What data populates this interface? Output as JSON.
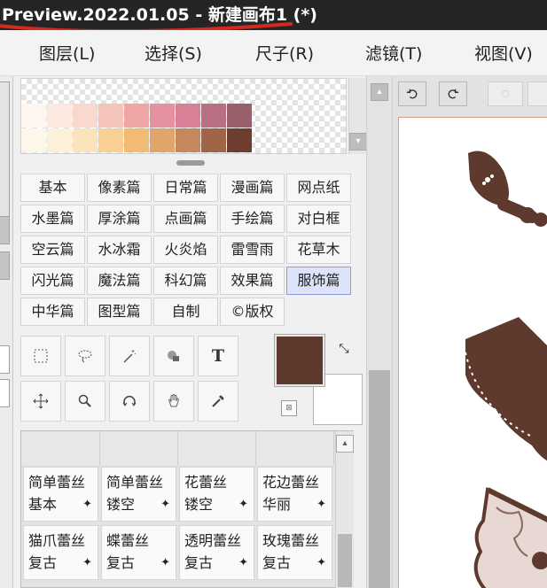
{
  "window": {
    "title": "Preview.2022.01.05 - 新建画布1 (*)"
  },
  "menu": [
    {
      "label": "图层(L)"
    },
    {
      "label": "选择(S)"
    },
    {
      "label": "尺子(R)"
    },
    {
      "label": "滤镜(T)"
    },
    {
      "label": "视图(V)"
    }
  ],
  "palette": {
    "row1": [
      "#fdf5ee",
      "#fbe9e0",
      "#f9d8cf",
      "#f4c3bb",
      "#eea7a4",
      "#e691a0",
      "#d88096",
      "#b97084",
      "#99606c"
    ],
    "row2": [
      "#fdf7e9",
      "#fcf0d8",
      "#fbe3bb",
      "#f8cf95",
      "#f1bb73",
      "#e1a46b",
      "#c5885c",
      "#a06447",
      "#6d3d2f"
    ]
  },
  "brush_categories": [
    [
      "基本",
      "像素篇",
      "日常篇",
      "漫画篇",
      "网点纸"
    ],
    [
      "水墨篇",
      "厚涂篇",
      "点画篇",
      "手绘篇",
      "对白框"
    ],
    [
      "空云篇",
      "水冰霜",
      "火炎焰",
      "雷雪雨",
      "花草木"
    ],
    [
      "闪光篇",
      "魔法篇",
      "科幻篇",
      "效果篇",
      "服饰篇"
    ],
    [
      "中华篇",
      "图型篇",
      "自制",
      "©版权"
    ]
  ],
  "selected_category": "服饰篇",
  "tools": {
    "text_tool_label": "T",
    "primary_color": "#5e3a2e",
    "secondary_color": "#ffffff"
  },
  "brushes": [
    {
      "line1": "简单蕾丝",
      "line2": "基本"
    },
    {
      "line1": "简单蕾丝",
      "line2": "镂空"
    },
    {
      "line1": "花蕾丝",
      "line2": "镂空"
    },
    {
      "line1": "花边蕾丝",
      "line2": "华丽"
    },
    {
      "line1": "猫爪蕾丝",
      "line2": "复古"
    },
    {
      "line1": "蝶蕾丝",
      "line2": "复古"
    },
    {
      "line1": "透明蕾丝",
      "line2": "复古"
    },
    {
      "line1": "玫瑰蕾丝",
      "line2": "复古"
    }
  ],
  "colors": {
    "lace_brown": "#5e3a2e",
    "lace_light": "#e8d8d4",
    "title_underline": "#d42a1e",
    "selected_category_bg": "#dde4f9"
  }
}
